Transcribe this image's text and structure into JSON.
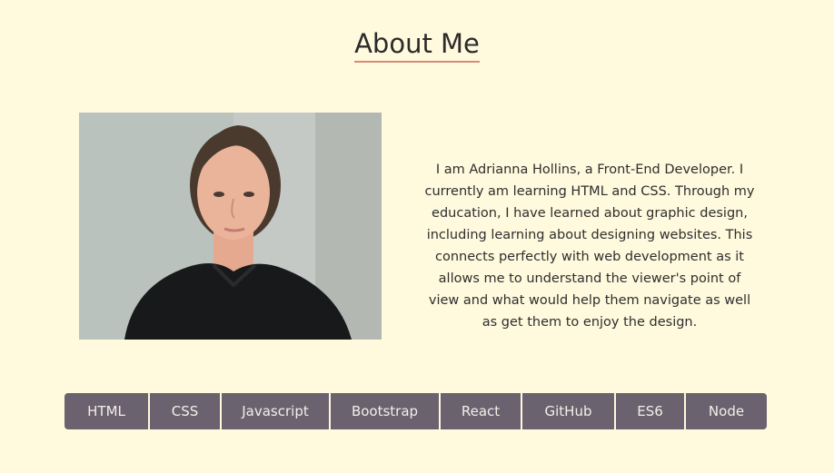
{
  "page": {
    "title": "About Me"
  },
  "photo": {
    "alt": "Portrait of Adrianna Hollins"
  },
  "bio": {
    "text": "I am Adrianna Hollins, a Front-End Developer. I currently am learning HTML and CSS. Through my education, I have learned about graphic design, including learning about designing websites. This connects perfectly with web development as it allows me to understand the viewer's point of view and what would help them navigate as well as get them to enjoy the design."
  },
  "skills": [
    {
      "label": "HTML"
    },
    {
      "label": "CSS"
    },
    {
      "label": "Javascript"
    },
    {
      "label": "Bootstrap"
    },
    {
      "label": "React"
    },
    {
      "label": "GitHub"
    },
    {
      "label": "ES6"
    },
    {
      "label": "Node"
    }
  ],
  "colors": {
    "background": "#fff9dd",
    "button": "#6b6270",
    "button_text": "#f3efe8",
    "title_underline": "#d98a77"
  }
}
